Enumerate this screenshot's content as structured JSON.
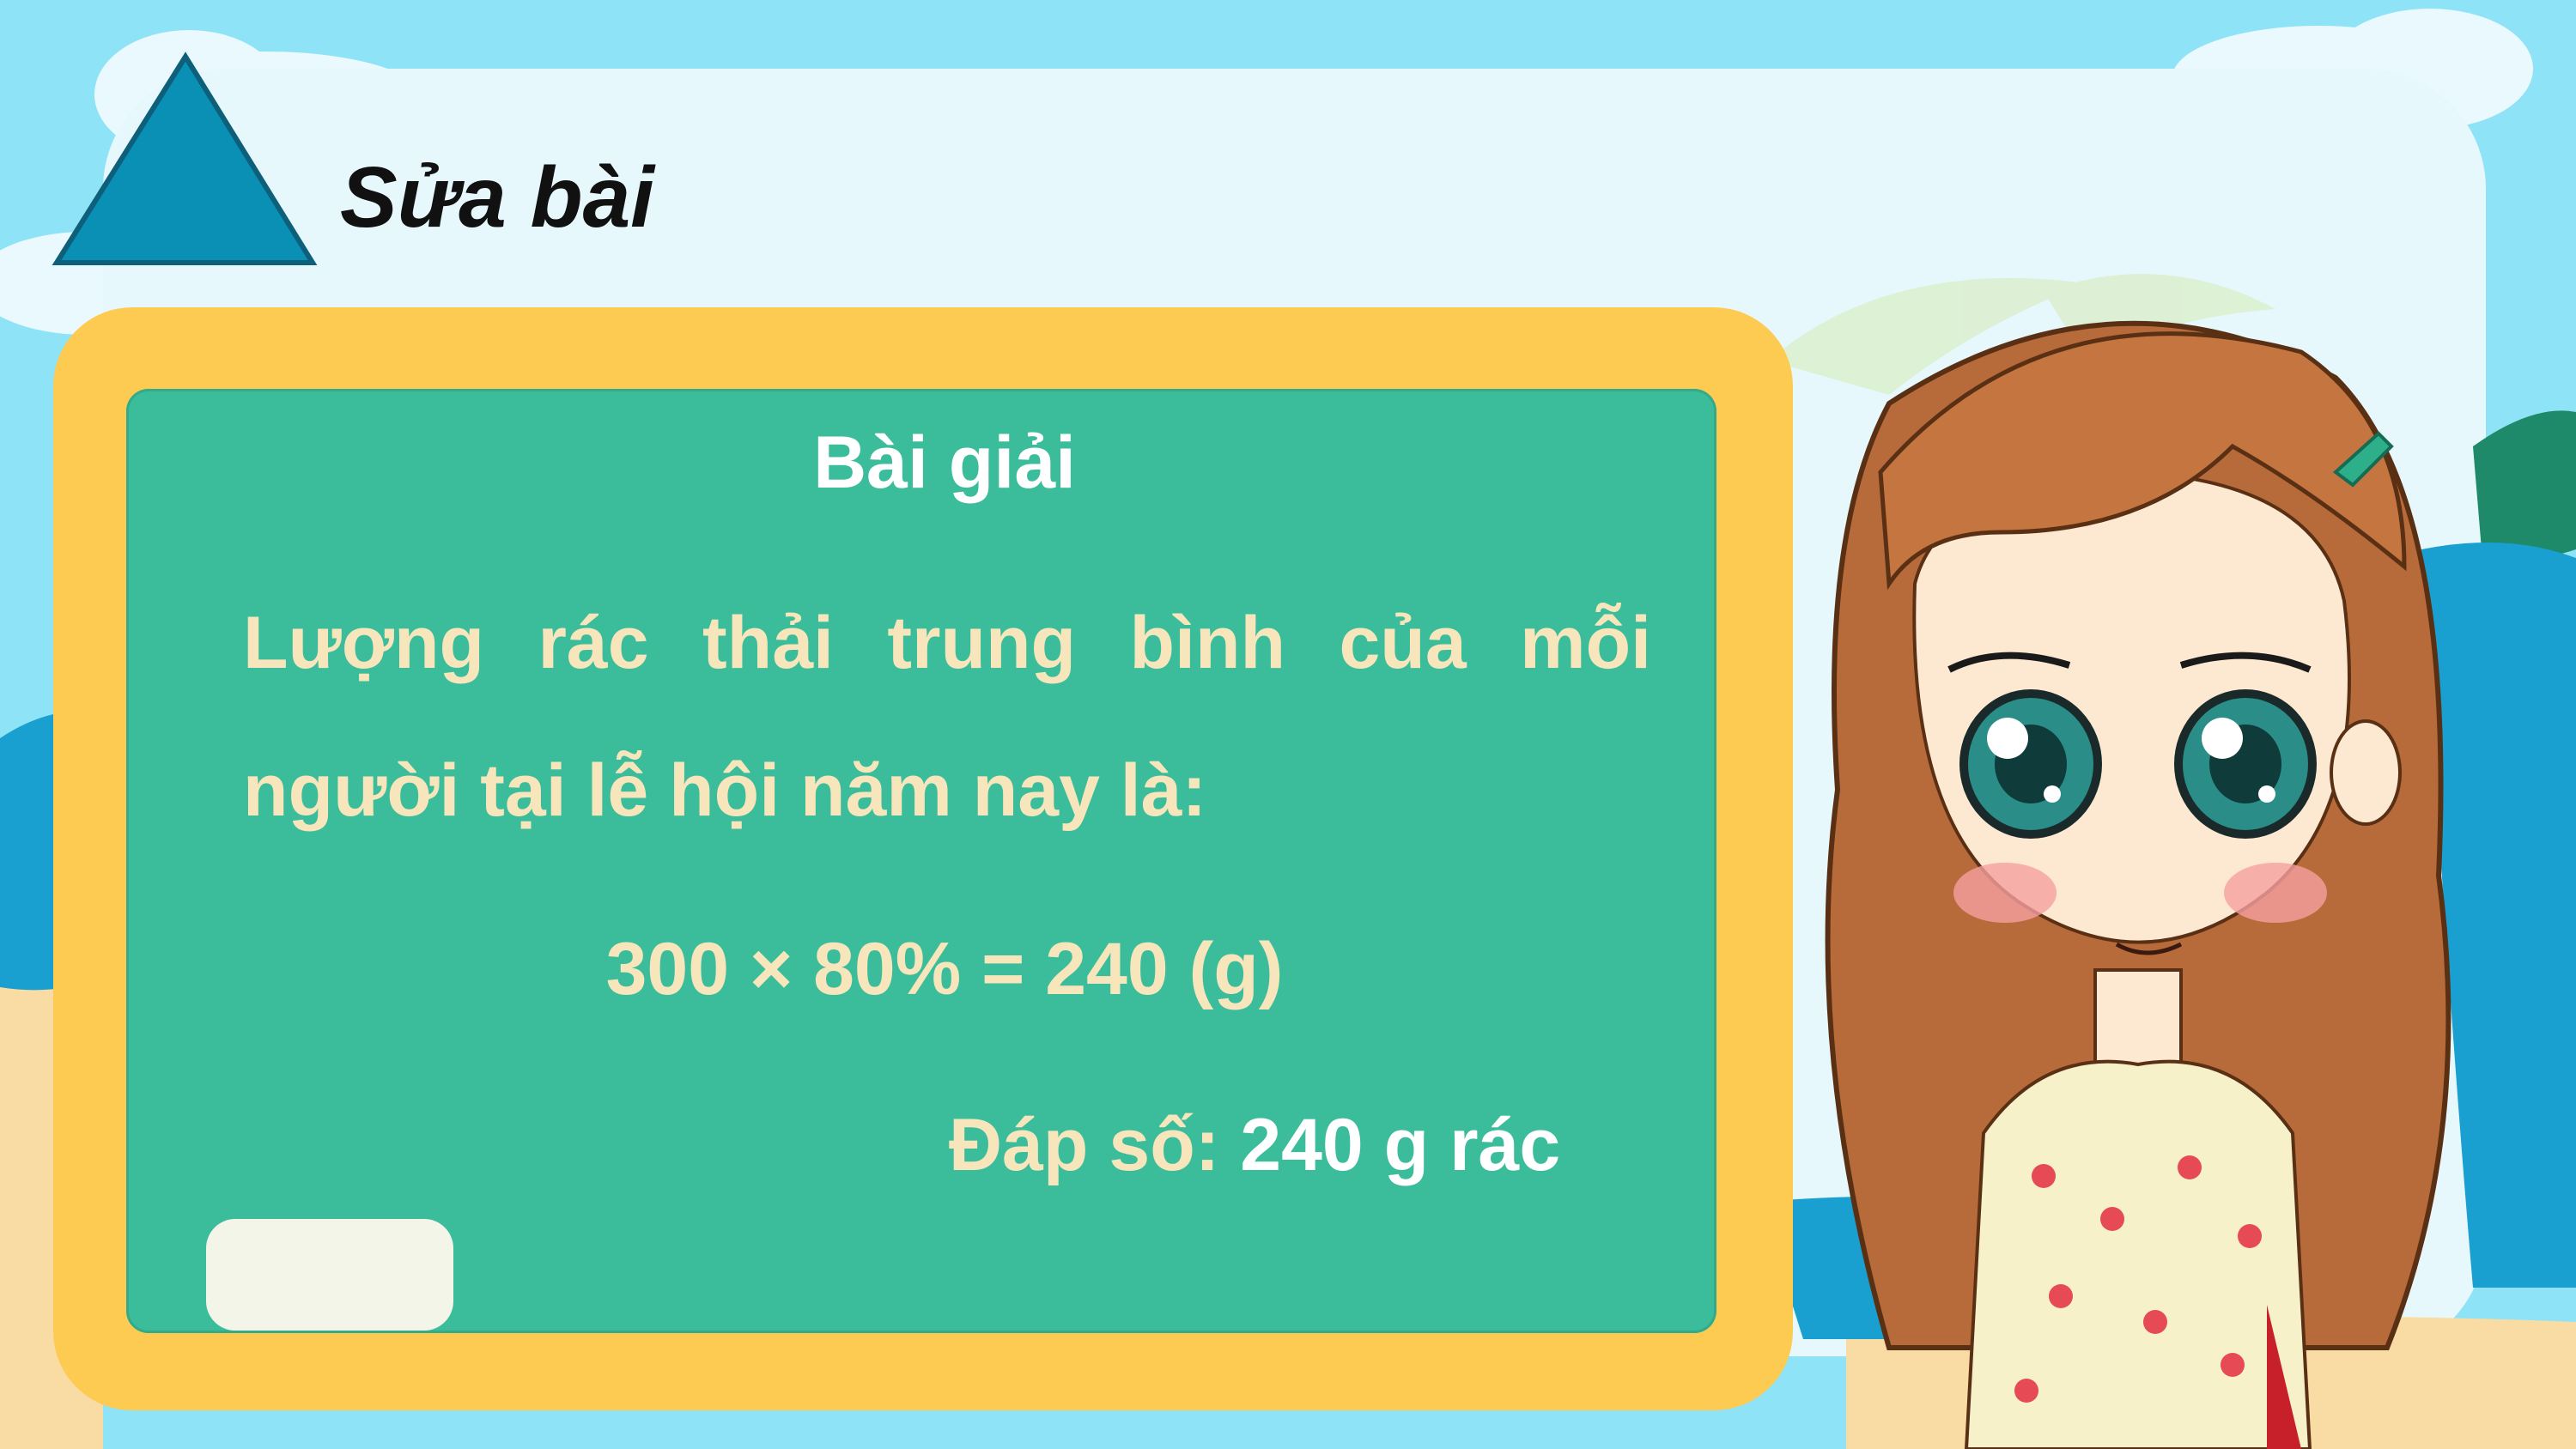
{
  "header": {
    "title": "Sửa bài"
  },
  "board": {
    "heading": "Bài giải",
    "line1": "Lượng rác thải trung bình của mỗi",
    "line2": "người tại lễ hội năm nay là:",
    "calculation": "300 × 80% = 240 (g)",
    "answer_label": "Đáp số: ",
    "answer_value": "240 g rác"
  },
  "colors": {
    "sky": "#8fe3f7",
    "panel": "#e7f8fd",
    "board_frame": "#fecb52",
    "board": "#3bbd9b",
    "board_text": "#f7e6bb",
    "triangle": "#0a8fb5"
  },
  "icons": {
    "title_marker": "triangle-icon"
  }
}
